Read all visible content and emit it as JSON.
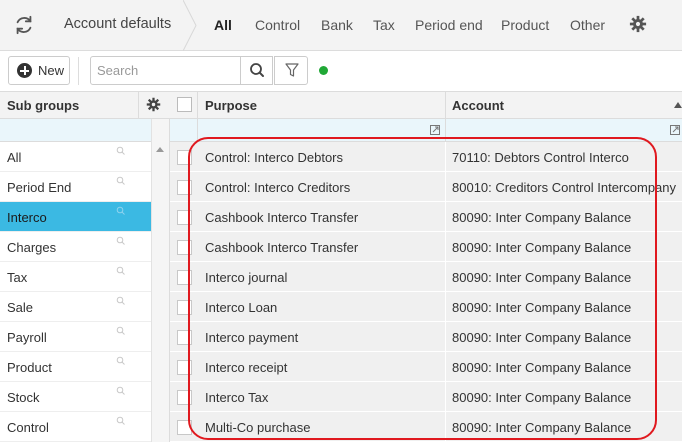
{
  "header": {
    "title": "Account defaults",
    "tabs": [
      {
        "label": "All",
        "active": true
      },
      {
        "label": "Control",
        "active": false
      },
      {
        "label": "Bank",
        "active": false
      },
      {
        "label": "Tax",
        "active": false
      },
      {
        "label": "Period end",
        "active": false
      },
      {
        "label": "Product",
        "active": false
      },
      {
        "label": "Other",
        "active": false
      }
    ],
    "icons": {
      "refresh": "refresh-icon",
      "settings": "gear-icon"
    }
  },
  "toolbar": {
    "new_label": "New",
    "search": {
      "placeholder": "Search",
      "value": ""
    },
    "status_color": "#20a836"
  },
  "subgroups": {
    "header": "Sub groups",
    "selected_color": "#3bb9e3",
    "items": [
      {
        "label": "All"
      },
      {
        "label": "Period End"
      },
      {
        "label": "Interco",
        "selected": true
      },
      {
        "label": "Charges"
      },
      {
        "label": "Tax"
      },
      {
        "label": "Sale"
      },
      {
        "label": "Payroll"
      },
      {
        "label": "Product"
      },
      {
        "label": "Stock"
      },
      {
        "label": "Control"
      }
    ]
  },
  "grid": {
    "columns": {
      "purpose": "Purpose",
      "account": "Account"
    },
    "sort": {
      "column": "Account",
      "direction": "ascending"
    },
    "rows": [
      {
        "purpose": "Control: Interco Debtors",
        "account": "70110: Debtors Control Interco"
      },
      {
        "purpose": "Control: Interco Creditors",
        "account": "80010: Creditors Control Intercompany"
      },
      {
        "purpose": "Cashbook Interco Transfer",
        "account": "80090: Inter Company Balance"
      },
      {
        "purpose": "Cashbook Interco Transfer",
        "account": "80090: Inter Company Balance"
      },
      {
        "purpose": "Interco journal",
        "account": "80090: Inter Company Balance"
      },
      {
        "purpose": "Interco Loan",
        "account": "80090: Inter Company Balance"
      },
      {
        "purpose": "Interco payment",
        "account": "80090: Inter Company Balance"
      },
      {
        "purpose": "Interco receipt",
        "account": "80090: Inter Company Balance"
      },
      {
        "purpose": "Interco Tax",
        "account": "80090: Inter Company Balance"
      },
      {
        "purpose": "Multi-Co purchase",
        "account": "80090: Inter Company Balance"
      }
    ]
  },
  "annotation_color": "#e0191f"
}
